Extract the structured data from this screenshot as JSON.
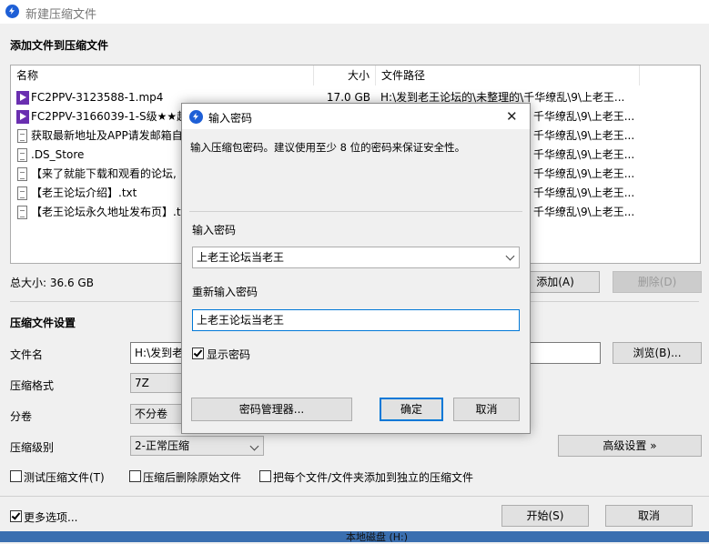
{
  "window": {
    "title": "新建压缩文件"
  },
  "add_section": {
    "heading": "添加文件到压缩文件"
  },
  "list": {
    "columns": {
      "name": "名称",
      "size": "大小",
      "path": "文件路径"
    },
    "rows": [
      {
        "icon": "mp4-file-icon",
        "name": "FC2PPV-3123588-1.mp4",
        "size": "17.0 GB",
        "path": "H:\\发到老王论坛的\\未整理的\\千华缭乱\\9\\上老王..."
      },
      {
        "icon": "mp4-file-icon",
        "name": "FC2PPV-3166039-1-S级★★超",
        "size": "",
        "path": "千华缭乱\\9\\上老王..."
      },
      {
        "icon": "text-file-icon",
        "name": "获取最新地址及APP请发邮箱自",
        "size": "",
        "path": "千华缭乱\\9\\上老王..."
      },
      {
        "icon": "blank-file-icon",
        "name": ".DS_Store",
        "size": "",
        "path": "千华缭乱\\9\\上老王..."
      },
      {
        "icon": "text-file-icon",
        "name": "【来了就能下载和观看的论坛,",
        "size": "",
        "path": "千华缭乱\\9\\上老王..."
      },
      {
        "icon": "text-file-icon",
        "name": "【老王论坛介绍】.txt",
        "size": "",
        "path": "千华缭乱\\9\\上老王..."
      },
      {
        "icon": "text-file-icon",
        "name": "【老王论坛永久地址发布页】.t",
        "size": "",
        "path": "千华缭乱\\9\\上老王..."
      }
    ]
  },
  "total": {
    "label": "总大小: 36.6 GB"
  },
  "buttons": {
    "add": "添加(A)",
    "delete": "删除(D)",
    "browse": "浏览(B)...",
    "advanced": "高级设置 »",
    "start": "开始(S)",
    "cancel": "取消"
  },
  "settings": {
    "heading": "压缩文件设置",
    "filename_label": "文件名",
    "filename_value": "H:\\发到老",
    "format_label": "压缩格式",
    "format_value": "7Z",
    "split_label": "分卷",
    "split_value": "不分卷",
    "level_label": "压缩级别",
    "level_value": "2-正常压缩",
    "test_label": "测试压缩文件(T)",
    "delete_after_label": "压缩后删除原始文件",
    "each_separate_label": "把每个文件/文件夹添加到独立的压缩文件",
    "more_options_label": "更多选项..."
  },
  "dialog": {
    "title": "输入密码",
    "description": "输入压缩包密码。建议使用至少 8 位的密码来保证安全性。",
    "password_label": "输入密码",
    "password_value": "上老王论坛当老王",
    "reenter_label": "重新输入密码",
    "reenter_value": "上老王论坛当老王",
    "show_password_label": "显示密码",
    "manager_button": "密码管理器...",
    "ok_button": "确定",
    "cancel_button": "取消",
    "close_glyph": "✕"
  },
  "background_fragment": {
    "text": "本地磁盘 (H:)"
  },
  "colors": {
    "accent": "#0078d7",
    "brand": "#1e5fd6"
  }
}
